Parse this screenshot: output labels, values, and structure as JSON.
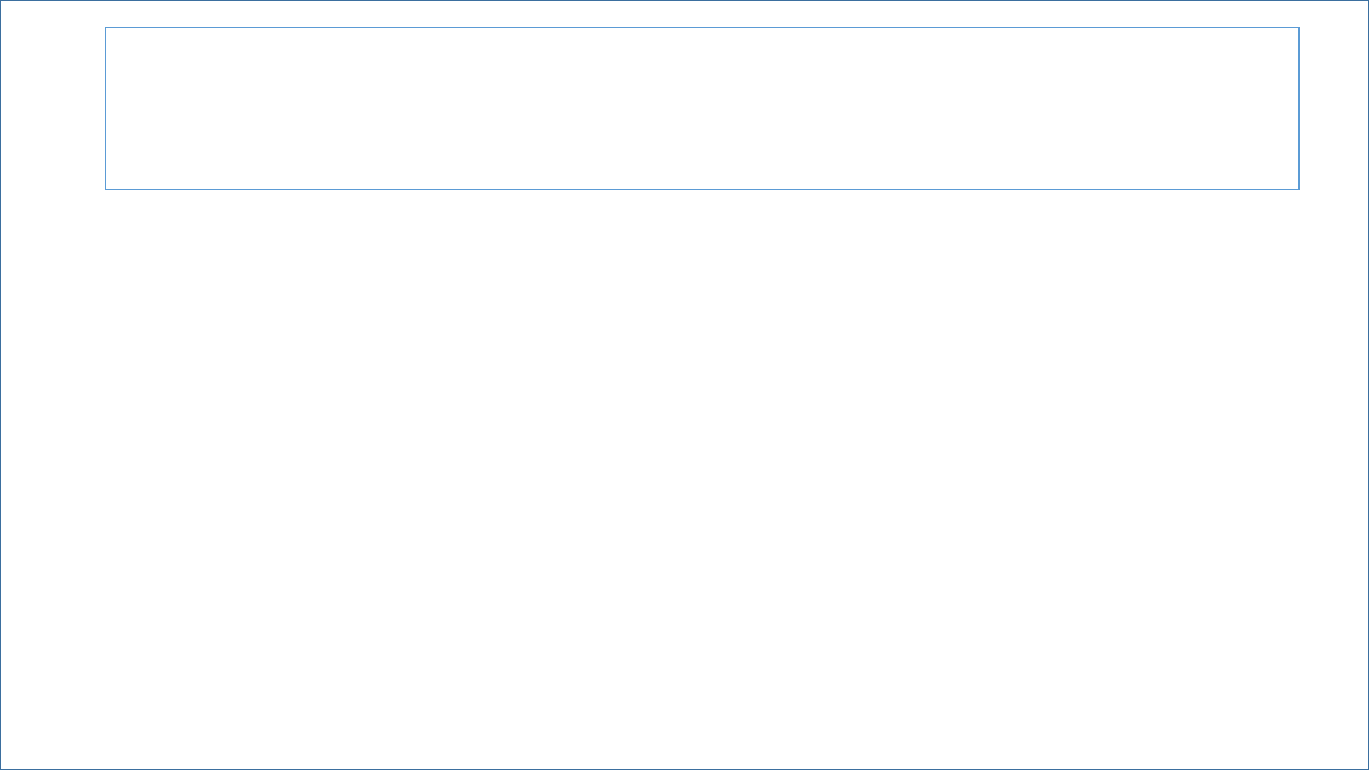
{
  "slide": {
    "text_box": {
      "empty": true
    }
  }
}
